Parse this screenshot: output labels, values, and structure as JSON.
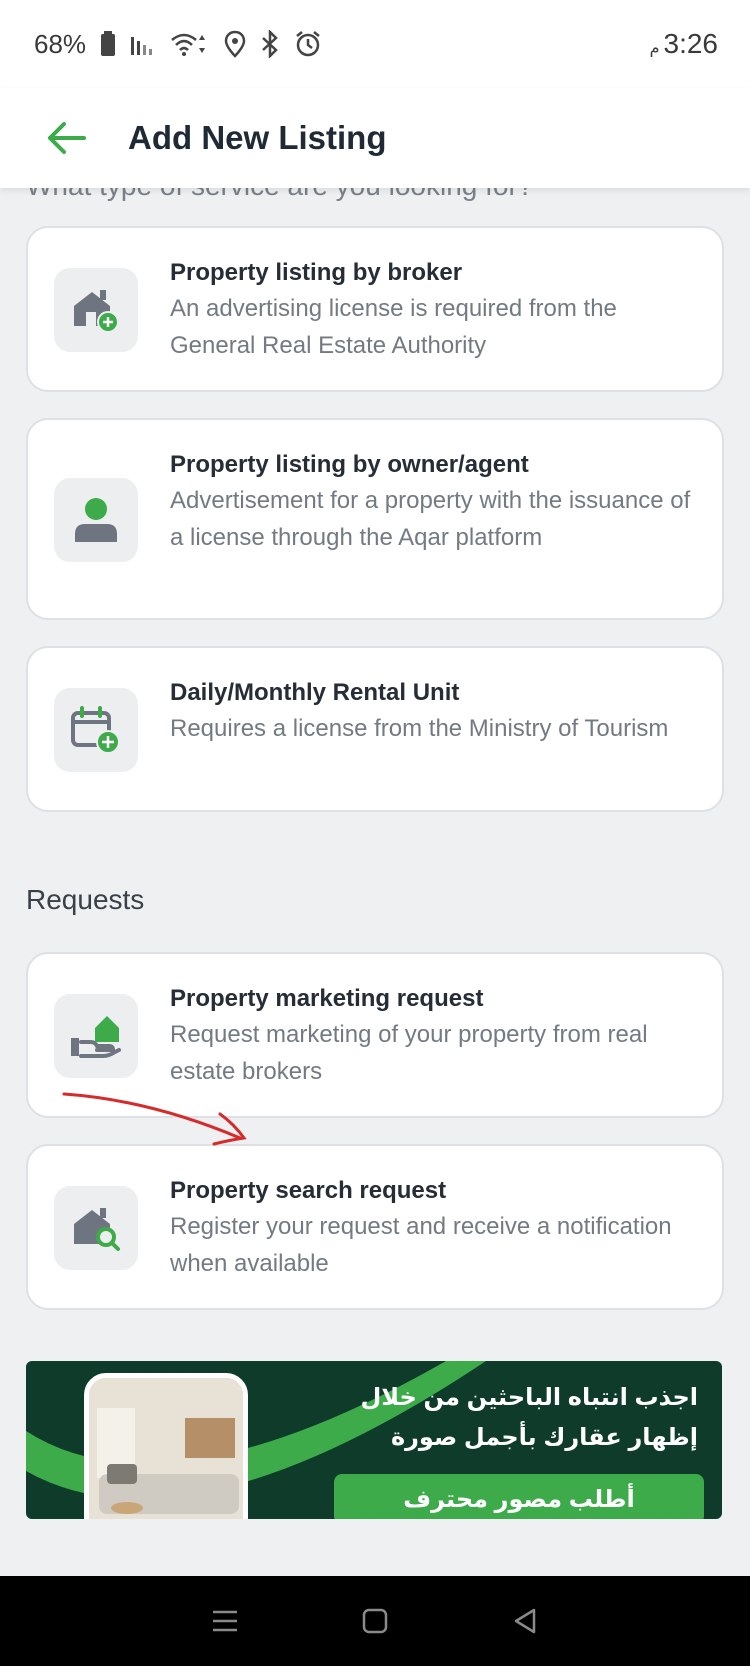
{
  "status_bar": {
    "battery": "68%",
    "time": "3:26",
    "ampm": "م",
    "icons": [
      "battery-icon",
      "signal-icon",
      "wifi-icon",
      "location-icon",
      "bluetooth-icon",
      "alarm-icon"
    ]
  },
  "app_bar": {
    "title": "Add New Listing",
    "back_icon": "arrow-left-icon"
  },
  "section_peek": "What type of service are you looking for?",
  "listings": [
    {
      "title": "Property listing by broker",
      "description": "An advertising license is required from the General Real Estate Authority",
      "icon": "house-plus-icon"
    },
    {
      "title": "Property listing by owner/agent",
      "description": "Advertisement for a property with the issuance of a license through the Aqar platform",
      "icon": "person-icon"
    },
    {
      "title": "Daily/Monthly Rental Unit",
      "description": "Requires a license from the Ministry of Tourism",
      "icon": "calendar-plus-icon"
    }
  ],
  "requests_label": "Requests",
  "requests": [
    {
      "title": "Property marketing request",
      "description": "Request marketing of your property from real estate brokers",
      "icon": "hand-house-icon"
    },
    {
      "title": "Property search request",
      "description": "Register your request and receive a notification when available",
      "icon": "house-search-icon"
    }
  ],
  "banner": {
    "line1": "اجذب انتباه الباحثين من خلال",
    "line2": "إظهار عقارك بأجمل صورة",
    "cta": "أطلب مصور محترف"
  },
  "colors": {
    "accent": "#3dab4a",
    "banner_bg": "#0f3b2a",
    "annotation_arrow": "#d62b2b"
  }
}
